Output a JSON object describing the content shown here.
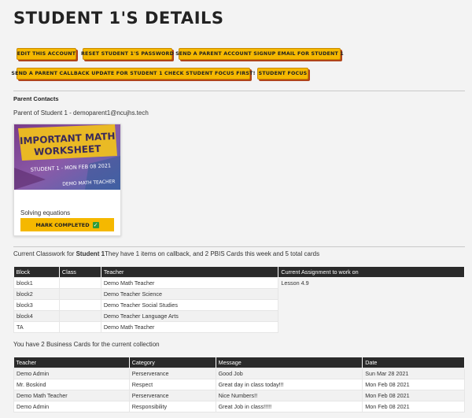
{
  "page_title": "STUDENT 1'S DETAILS",
  "buttons": {
    "edit": "EDIT THIS ACCOUNT",
    "reset": "RESET STUDENT 1'S PASSWORD",
    "signup": "SEND A PARENT ACCOUNT SIGNUP EMAIL FOR STUDENT 1",
    "callback": "SEND A PARENT CALLBACK UPDATE FOR STUDENT 1 CHECK STUDENT FOCUS FIRST!",
    "focus": "STUDENT FOCUS"
  },
  "parent_contacts": {
    "heading": "Parent Contacts",
    "line": "Parent of Student 1 - demoparent1@ncujhs.tech"
  },
  "worksheet_card": {
    "image_title_1": "IMPORTANT MATH",
    "image_title_2": "WORKSHEET",
    "image_subtitle": "STUDENT 1 - MON FEB 08 2021",
    "image_teacher": "DEMO MATH TEACHER",
    "caption": "Solving equations",
    "mark_button": "MARK COMPLETED"
  },
  "classwork": {
    "prefix": "Current Classwork for ",
    "student": "Student 1",
    "suffix": "They have 1 items on callback, and 2 PBIS Cards this week and 5 total cards",
    "headers": [
      "Block",
      "Class",
      "Teacher",
      "Current Assignment to work on"
    ],
    "rows": [
      {
        "block": "block1",
        "class": "",
        "teacher": "Demo Math Teacher",
        "assignment": "Lesson 4.9"
      },
      {
        "block": "block2",
        "class": "",
        "teacher": "Demo Teacher Science",
        "assignment": ""
      },
      {
        "block": "block3",
        "class": "",
        "teacher": "Demo Teacher Social Studies",
        "assignment": ""
      },
      {
        "block": "block4",
        "class": "",
        "teacher": "Demo Teacher Language Arts",
        "assignment": ""
      },
      {
        "block": "TA",
        "class": "",
        "teacher": "Demo Math Teacher",
        "assignment": ""
      }
    ]
  },
  "business_cards": {
    "line": "You have 2 Business Cards for the current collection",
    "headers": [
      "Teacher",
      "Category",
      "Message",
      "Date"
    ],
    "rows": [
      {
        "teacher": "Demo Admin",
        "category": "Perserverance",
        "message": "Good Job",
        "date": "Sun Mar 28 2021"
      },
      {
        "teacher": "Mr. Boskind",
        "category": "Respect",
        "message": "Great day in class today!!!",
        "date": "Mon Feb 08 2021"
      },
      {
        "teacher": "Demo Math Teacher",
        "category": "Perserverance",
        "message": "Nice Numbers!!",
        "date": "Mon Feb 08 2021"
      },
      {
        "teacher": "Demo Admin",
        "category": "Responsibility",
        "message": "Great Job in class!!!!!",
        "date": "Mon Feb 08 2021"
      }
    ]
  },
  "colors": {
    "button_bg": "#f5b800",
    "button_shadow": "#b0441a",
    "table_header": "#2a2a2a",
    "check_green": "#2e9b3a"
  }
}
